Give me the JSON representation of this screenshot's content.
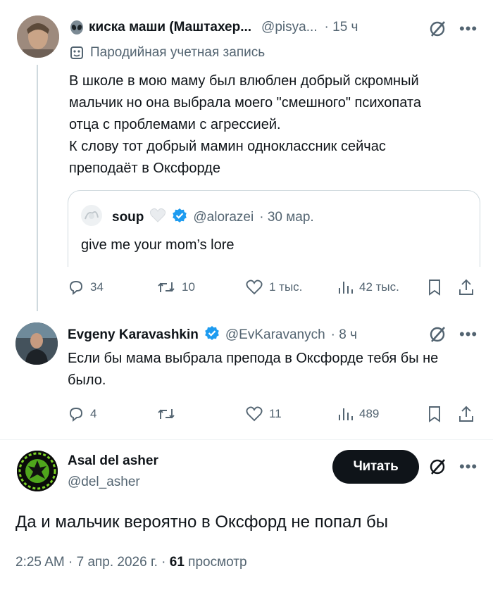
{
  "tweet1": {
    "name": "киска маши (Маштахер...",
    "handle": "@pisya...",
    "time": "· 15 ч",
    "parody_label": "Пародийная учетная запись",
    "text_lines": [
      "В школе в мою маму был влюблен добрый скромный",
      "мальчик но она выбрала моего \"смешного\" психопата",
      "отца с проблемами с агрессией.",
      "К слову тот добрый мамин одноклассник сейчас",
      "преподаёт в Оксфорде"
    ],
    "quote": {
      "name": "soup",
      "handle": "@alorazei",
      "date": "· 30 мар.",
      "text": "give me your mom’s lore"
    },
    "actions": {
      "replies": "34",
      "reposts": "10",
      "likes": "1 тыс.",
      "views": "42 тыс."
    }
  },
  "tweet2": {
    "name": "Evgeny Karavashkin",
    "handle": "@EvKaravanych",
    "time": "· 8 ч",
    "text_lines": [
      "Если бы мама выбрала препода в Оксфорде тебя бы не",
      "было."
    ],
    "actions": {
      "replies": "4",
      "reposts": "",
      "likes": "11",
      "views": "489"
    }
  },
  "tweet3": {
    "name": "Asal del asher",
    "handle": "@del_asher",
    "follow_label": "Читать",
    "text": "Да и мальчик вероятно в Оксфорд не попал бы",
    "timestamp": "2:25 AM · 7 апр. 2026 г. ·",
    "views_count": "61",
    "views_label": "просмотр"
  },
  "colors": {
    "text": "#0f1419",
    "muted": "#536471",
    "verified": "#1d9bf0",
    "border": "#cfd9de",
    "button_bg": "#0f1419"
  },
  "icons": [
    "alien-icon",
    "parody-mask-icon",
    "verified-badge-icon",
    "grok-icon",
    "more-icon",
    "reply-icon",
    "repost-icon",
    "like-icon",
    "views-icon",
    "bookmark-icon",
    "share-icon",
    "heart-emoji-icon"
  ]
}
